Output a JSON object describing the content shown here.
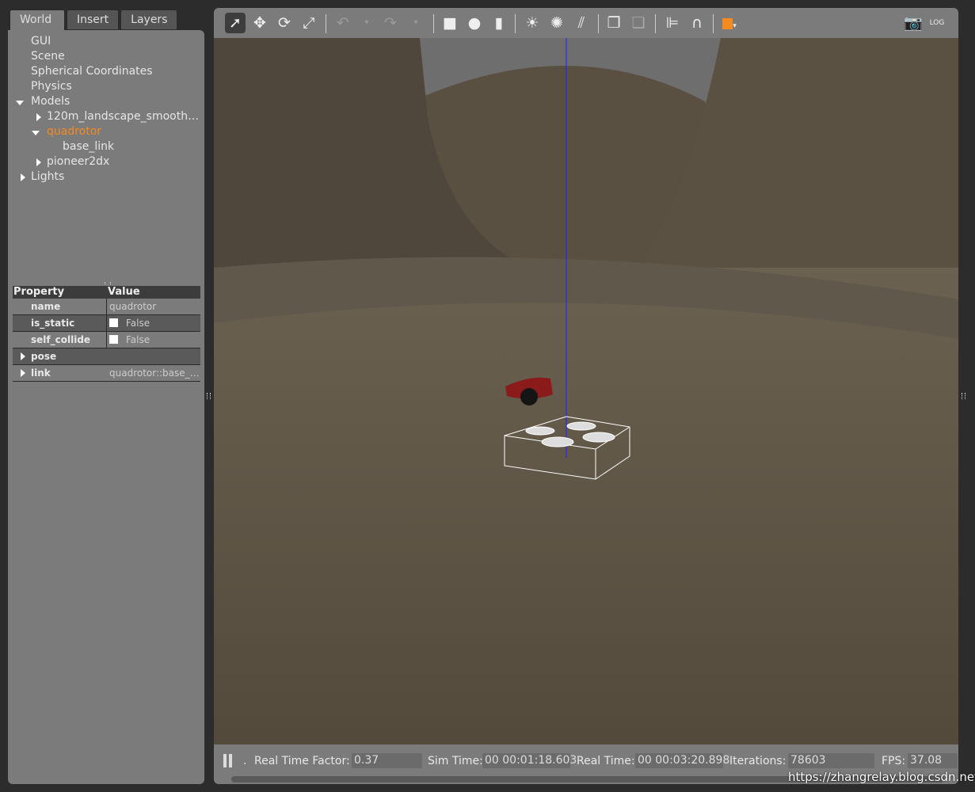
{
  "tabs": [
    {
      "label": "World"
    },
    {
      "label": "Insert"
    },
    {
      "label": "Layers"
    }
  ],
  "tree": {
    "items": [
      "GUI",
      "Scene",
      "Spherical Coordinates",
      "Physics",
      "Models",
      "120m_landscape_smooth…",
      "quadrotor",
      "base_link",
      "pioneer2dx",
      "Lights"
    ]
  },
  "properties": {
    "header_property": "Property",
    "header_value": "Value",
    "rows": [
      {
        "key": "name",
        "value": "quadrotor"
      },
      {
        "key": "is_static",
        "value": "False"
      },
      {
        "key": "self_collide",
        "value": "False"
      },
      {
        "key": "pose",
        "value": ""
      },
      {
        "key": "link",
        "value": "quadrotor::base_…"
      }
    ]
  },
  "toolbar": {
    "icons": [
      "select-arrow",
      "translate",
      "rotate",
      "scale",
      "undo",
      "redo",
      "box",
      "sphere",
      "cylinder",
      "point-light",
      "spot-light",
      "directional-light",
      "copy",
      "paste",
      "align",
      "snap",
      "view-angle",
      "screenshot",
      "log"
    ],
    "accent": "#f58a1f"
  },
  "status": {
    "rtf_label": "Real Time Factor:",
    "rtf": "0.37",
    "sim_label": "Sim Time:",
    "sim": "00 00:01:18.603",
    "real_label": "Real Time:",
    "real": "00 00:03:20.898",
    "iter_label": "Iterations:",
    "iter": "78603",
    "fps_label": "FPS:",
    "fps": "37.08",
    "step": "."
  },
  "watermark": "https://zhangrelay.blog.csdn.net"
}
